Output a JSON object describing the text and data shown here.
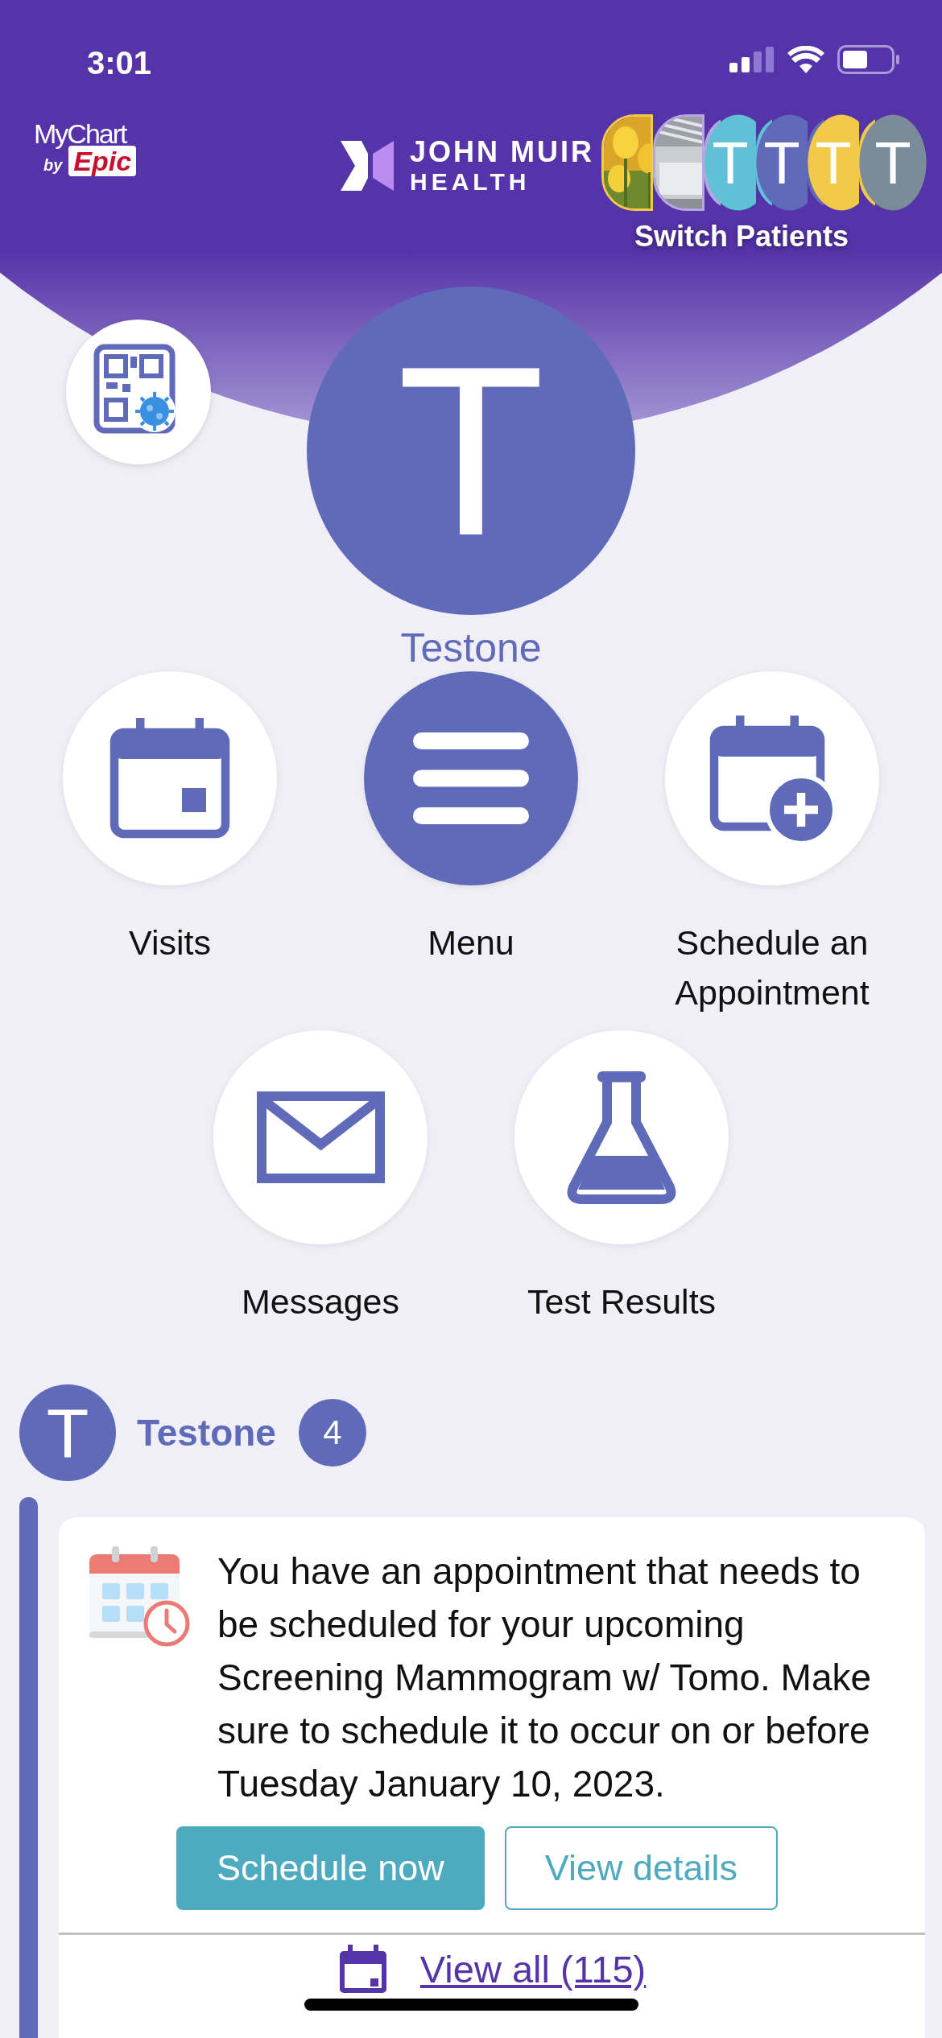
{
  "status_bar": {
    "time": "3:01"
  },
  "header": {
    "app_logo": {
      "name": "MyChart",
      "by": "by",
      "brand": "Epic"
    },
    "org_logo": {
      "line_1": "JOHN MUIR",
      "line_2": "HEALTH"
    },
    "patients": [
      {
        "kind": "picture",
        "color": "#f3c94a"
      },
      {
        "kind": "picture",
        "color": "#b7a6e0"
      },
      {
        "kind": "initial",
        "initial": "T",
        "color": "#5fc0d6"
      },
      {
        "kind": "initial",
        "initial": "T",
        "color": "#5f6bb8"
      },
      {
        "kind": "initial",
        "initial": "T",
        "color": "#f3c94a"
      },
      {
        "kind": "initial",
        "initial": "T",
        "color": "#7a8c99"
      }
    ],
    "switch_label": "Switch Patients"
  },
  "profile": {
    "initial": "T",
    "name": "Testone"
  },
  "shortcuts": [
    {
      "kind": "visits",
      "label": "Visits",
      "highlighted": false
    },
    {
      "kind": "menu",
      "label": "Menu",
      "highlighted": true
    },
    {
      "kind": "schedule",
      "label": "Schedule an Appointment",
      "highlighted": false
    },
    {
      "kind": "messages",
      "label": "Messages",
      "highlighted": false
    },
    {
      "kind": "results",
      "label": "Test Results",
      "highlighted": false
    }
  ],
  "feed": {
    "patient": {
      "initial": "T",
      "name": "Testone",
      "count": "4"
    },
    "card": {
      "message": "You have an appointment that needs to be scheduled for your upcoming Screening Mammogram w/ Tomo. Make sure to schedule it to occur on or before Tuesday January 10, 2023.",
      "buttons": [
        {
          "kind": "primary",
          "label": "Schedule now"
        },
        {
          "kind": "outline",
          "label": "View details"
        }
      ],
      "view_all": "View all (115)"
    }
  }
}
